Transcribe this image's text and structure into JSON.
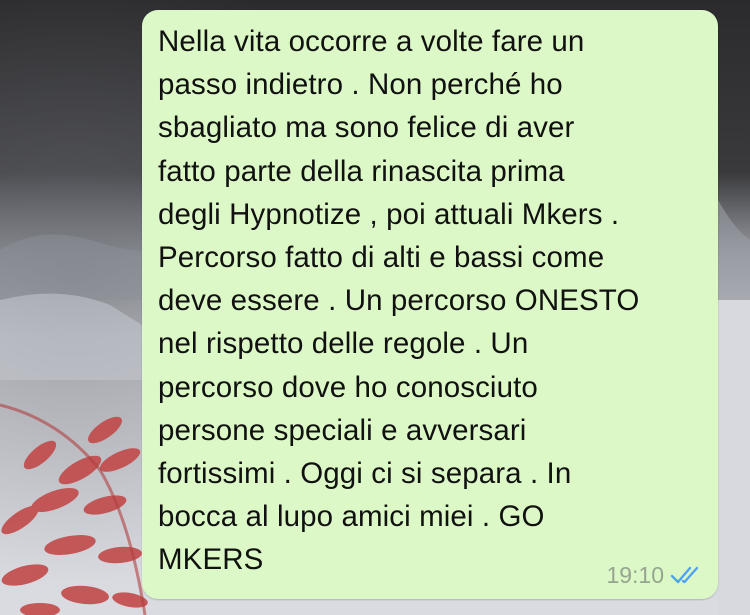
{
  "chat": {
    "message": {
      "lines": [
        "Nella vita occorre a volte fare un",
        "passo indietro . Non perché ho",
        "sbagliato ma sono felice di aver",
        "fatto parte della rinascita prima",
        "degli Hypnotize , poi attuali Mkers .",
        "Percorso fatto di alti e bassi come",
        "deve essere . Un percorso ONESTO",
        "nel rispetto delle regole . Un",
        "percorso dove ho conosciuto",
        "persone speciali e avversari",
        "fortissimi . Oggi ci si separa . In",
        "bocca al lupo amici miei . GO",
        "MKERS"
      ],
      "time": "19:10",
      "status_icon": "read-double-check-icon",
      "bubble_color": "#dcf8c6",
      "tick_color": "#4fa3f7"
    }
  }
}
